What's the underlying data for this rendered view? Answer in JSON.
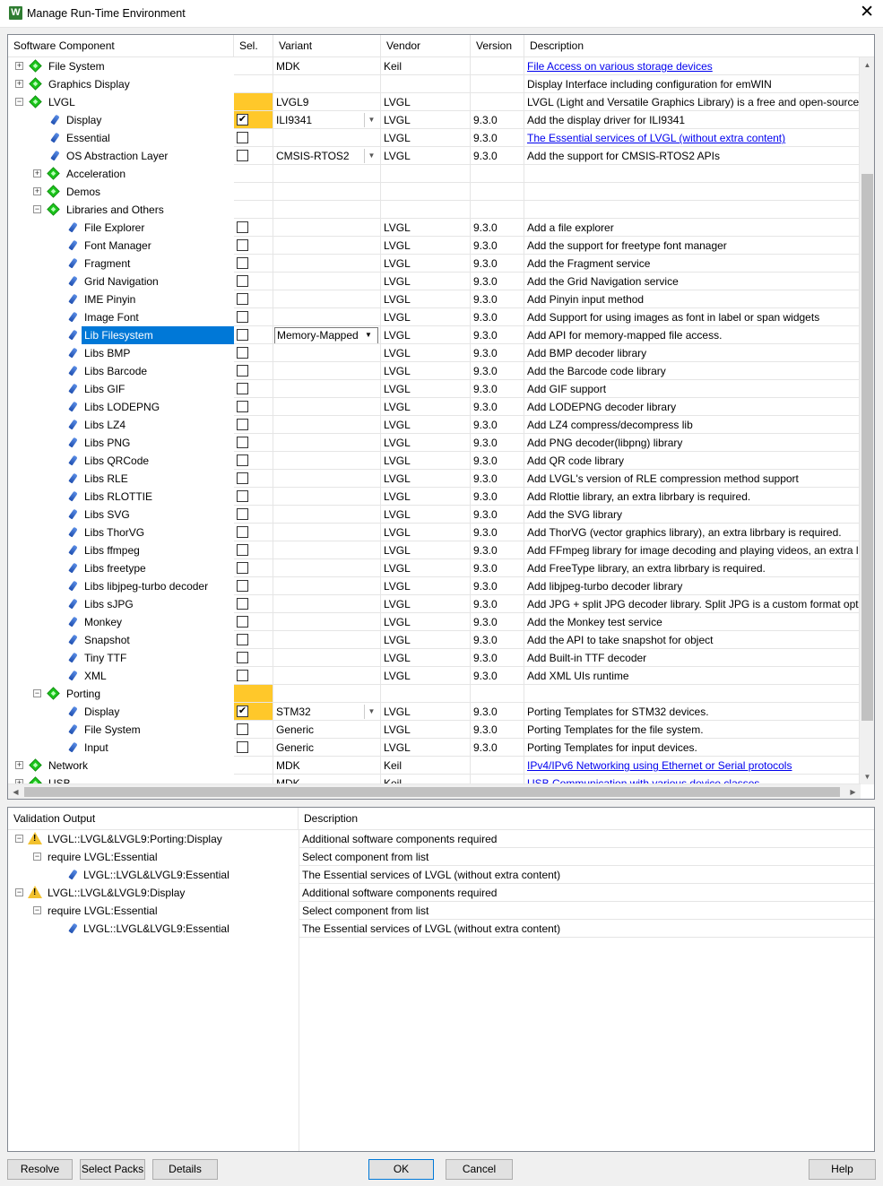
{
  "window": {
    "title": "Manage Run-Time Environment",
    "app_icon": "W",
    "close_glyph": "✕"
  },
  "columns": {
    "component": "Software Component",
    "sel": "Sel.",
    "variant": "Variant",
    "vendor": "Vendor",
    "version": "Version",
    "description": "Description"
  },
  "rows": [
    {
      "level": 0,
      "exp": "+",
      "icon": "gem",
      "label": "File System",
      "variant": "MDK",
      "vendor": "Keil",
      "desc": "File Access on various storage devices",
      "link": true
    },
    {
      "level": 0,
      "exp": "+",
      "icon": "gem",
      "label": "Graphics Display",
      "desc": "Display Interface including configuration for emWIN"
    },
    {
      "level": 0,
      "exp": "-",
      "icon": "gem",
      "label": "LVGL",
      "sel": "orange",
      "variant": "LVGL9",
      "vendor": "LVGL",
      "desc": "LVGL (Light and Versatile Graphics Library) is a free and open-source graphics library"
    },
    {
      "level": 1,
      "icon": "pin",
      "label": "Display",
      "sel": "checked-orange",
      "variant": "ILI9341",
      "dd": true,
      "vendor": "LVGL",
      "version": "9.3.0",
      "desc": "Add the display driver for ILI9341"
    },
    {
      "level": 1,
      "icon": "pin",
      "label": "Essential",
      "sel": "unchecked",
      "vendor": "LVGL",
      "version": "9.3.0",
      "desc": "The Essential services of LVGL (without extra content)",
      "link": true
    },
    {
      "level": 1,
      "icon": "pin",
      "label": "OS Abstraction Layer",
      "sel": "unchecked",
      "variant": "CMSIS-RTOS2",
      "dd": true,
      "vendor": "LVGL",
      "version": "9.3.0",
      "desc": "Add the support for CMSIS-RTOS2 APIs"
    },
    {
      "level": 1,
      "exp": "+",
      "icon": "gem",
      "label": "Acceleration"
    },
    {
      "level": 1,
      "exp": "+",
      "icon": "gem",
      "label": "Demos"
    },
    {
      "level": 1,
      "exp": "-",
      "icon": "gem",
      "label": "Libraries and Others"
    },
    {
      "level": 2,
      "icon": "pin",
      "label": "File Explorer",
      "sel": "unchecked",
      "vendor": "LVGL",
      "version": "9.3.0",
      "desc": "Add a file explorer"
    },
    {
      "level": 2,
      "icon": "pin",
      "label": "Font Manager",
      "sel": "unchecked",
      "vendor": "LVGL",
      "version": "9.3.0",
      "desc": "Add the support for freetype font manager"
    },
    {
      "level": 2,
      "icon": "pin",
      "label": "Fragment",
      "sel": "unchecked",
      "vendor": "LVGL",
      "version": "9.3.0",
      "desc": "Add the Fragment service"
    },
    {
      "level": 2,
      "icon": "pin",
      "label": "Grid Navigation",
      "sel": "unchecked",
      "vendor": "LVGL",
      "version": "9.3.0",
      "desc": "Add the Grid Navigation service"
    },
    {
      "level": 2,
      "icon": "pin",
      "label": "IME Pinyin",
      "sel": "unchecked",
      "vendor": "LVGL",
      "version": "9.3.0",
      "desc": "Add Pinyin input method"
    },
    {
      "level": 2,
      "icon": "pin",
      "label": "Image Font",
      "sel": "unchecked",
      "vendor": "LVGL",
      "version": "9.3.0",
      "desc": "Add Support for using images as font in label or span widgets"
    },
    {
      "level": 2,
      "icon": "pin",
      "label": "Lib Filesystem",
      "selected": true,
      "sel": "unchecked",
      "variant": "Memory-Mapped",
      "dd_open": true,
      "vendor": "LVGL",
      "version": "9.3.0",
      "desc": "Add API for memory-mapped file access."
    },
    {
      "level": 2,
      "icon": "pin",
      "label": "Libs BMP",
      "sel": "unchecked",
      "vendor": "LVGL",
      "version": "9.3.0",
      "desc": "Add BMP decoder library"
    },
    {
      "level": 2,
      "icon": "pin",
      "label": "Libs Barcode",
      "sel": "unchecked",
      "vendor": "LVGL",
      "version": "9.3.0",
      "desc": "Add the Barcode code library"
    },
    {
      "level": 2,
      "icon": "pin",
      "label": "Libs GIF",
      "sel": "unchecked",
      "vendor": "LVGL",
      "version": "9.3.0",
      "desc": "Add GIF support"
    },
    {
      "level": 2,
      "icon": "pin",
      "label": "Libs LODEPNG",
      "sel": "unchecked",
      "vendor": "LVGL",
      "version": "9.3.0",
      "desc": "Add LODEPNG decoder library"
    },
    {
      "level": 2,
      "icon": "pin",
      "label": "Libs LZ4",
      "sel": "unchecked",
      "vendor": "LVGL",
      "version": "9.3.0",
      "desc": "Add LZ4 compress/decompress lib"
    },
    {
      "level": 2,
      "icon": "pin",
      "label": "Libs PNG",
      "sel": "unchecked",
      "vendor": "LVGL",
      "version": "9.3.0",
      "desc": "Add PNG decoder(libpng) library"
    },
    {
      "level": 2,
      "icon": "pin",
      "label": "Libs QRCode",
      "sel": "unchecked",
      "vendor": "LVGL",
      "version": "9.3.0",
      "desc": "Add QR code library"
    },
    {
      "level": 2,
      "icon": "pin",
      "label": "Libs RLE",
      "sel": "unchecked",
      "vendor": "LVGL",
      "version": "9.3.0",
      "desc": "Add LVGL's version of RLE compression method support"
    },
    {
      "level": 2,
      "icon": "pin",
      "label": "Libs RLOTTIE",
      "sel": "unchecked",
      "vendor": "LVGL",
      "version": "9.3.0",
      "desc": "Add Rlottie library, an extra librbary is required."
    },
    {
      "level": 2,
      "icon": "pin",
      "label": "Libs SVG",
      "sel": "unchecked",
      "vendor": "LVGL",
      "version": "9.3.0",
      "desc": "Add the SVG library"
    },
    {
      "level": 2,
      "icon": "pin",
      "label": "Libs ThorVG",
      "sel": "unchecked",
      "vendor": "LVGL",
      "version": "9.3.0",
      "desc": "Add ThorVG (vector graphics library), an extra librbary is required."
    },
    {
      "level": 2,
      "icon": "pin",
      "label": "Libs ffmpeg",
      "sel": "unchecked",
      "vendor": "LVGL",
      "version": "9.3.0",
      "desc": "Add FFmpeg library for image decoding and playing videos, an extra librbary is required."
    },
    {
      "level": 2,
      "icon": "pin",
      "label": "Libs freetype",
      "sel": "unchecked",
      "vendor": "LVGL",
      "version": "9.3.0",
      "desc": "Add FreeType library, an extra librbary is required."
    },
    {
      "level": 2,
      "icon": "pin",
      "label": "Libs libjpeg-turbo decoder",
      "sel": "unchecked",
      "vendor": "LVGL",
      "version": "9.3.0",
      "desc": "Add libjpeg-turbo decoder library"
    },
    {
      "level": 2,
      "icon": "pin",
      "label": "Libs sJPG",
      "sel": "unchecked",
      "vendor": "LVGL",
      "version": "9.3.0",
      "desc": "Add JPG + split JPG decoder library. Split JPG is a custom format optimized for embedded"
    },
    {
      "level": 2,
      "icon": "pin",
      "label": "Monkey",
      "sel": "unchecked",
      "vendor": "LVGL",
      "version": "9.3.0",
      "desc": "Add the Monkey test service"
    },
    {
      "level": 2,
      "icon": "pin",
      "label": "Snapshot",
      "sel": "unchecked",
      "vendor": "LVGL",
      "version": "9.3.0",
      "desc": "Add the API to take snapshot for object"
    },
    {
      "level": 2,
      "icon": "pin",
      "label": "Tiny TTF",
      "sel": "unchecked",
      "vendor": "LVGL",
      "version": "9.3.0",
      "desc": "Add Built-in TTF decoder"
    },
    {
      "level": 2,
      "icon": "pin",
      "label": "XML",
      "sel": "unchecked",
      "vendor": "LVGL",
      "version": "9.3.0",
      "desc": "Add XML UIs runtime"
    },
    {
      "level": 1,
      "exp": "-",
      "icon": "gem",
      "label": "Porting",
      "sel": "orange"
    },
    {
      "level": 2,
      "icon": "pin",
      "label": "Display",
      "sel": "checked-orange",
      "variant": "STM32",
      "dd": true,
      "vendor": "LVGL",
      "version": "9.3.0",
      "desc": "Porting Templates for STM32 devices."
    },
    {
      "level": 2,
      "icon": "pin",
      "label": "File System",
      "sel": "unchecked",
      "variant": "Generic",
      "vendor": "LVGL",
      "version": "9.3.0",
      "desc": "Porting Templates for the file system."
    },
    {
      "level": 2,
      "icon": "pin",
      "label": "Input",
      "sel": "unchecked",
      "variant": "Generic",
      "vendor": "LVGL",
      "version": "9.3.0",
      "desc": "Porting Templates for input devices."
    },
    {
      "level": 0,
      "exp": "+",
      "icon": "gem",
      "label": "Network",
      "variant": "MDK",
      "vendor": "Keil",
      "desc": "IPv4/IPv6 Networking using Ethernet or Serial protocols",
      "link": true
    },
    {
      "level": 0,
      "exp": "+",
      "icon": "gem",
      "label": "USB",
      "variant": "MDK",
      "vendor": "Keil",
      "desc": "USB Communication with various device classes",
      "link": true
    }
  ],
  "validation": {
    "col_output": "Validation Output",
    "col_description": "Description",
    "rows": [
      {
        "level": 0,
        "exp": "-",
        "warn": true,
        "label": "LVGL::LVGL&LVGL9:Porting:Display",
        "desc": "Additional software components required"
      },
      {
        "level": 1,
        "exp": "-",
        "label": "require LVGL:Essential",
        "desc": "Select component from list"
      },
      {
        "level": 2,
        "pin": true,
        "label": "LVGL::LVGL&LVGL9:Essential",
        "desc": "The Essential services of LVGL (without extra content)"
      },
      {
        "level": 0,
        "exp": "-",
        "warn": true,
        "label": "LVGL::LVGL&LVGL9:Display",
        "desc": "Additional software components required"
      },
      {
        "level": 1,
        "exp": "-",
        "label": "require LVGL:Essential",
        "desc": "Select component from list"
      },
      {
        "level": 2,
        "pin": true,
        "label": "LVGL::LVGL&LVGL9:Essential",
        "desc": "The Essential services of LVGL (without extra content)"
      }
    ]
  },
  "buttons": {
    "resolve": "Resolve",
    "select_packs": "Select Packs",
    "details": "Details",
    "ok": "OK",
    "cancel": "Cancel",
    "help": "Help"
  },
  "colors": {
    "selection": "#0078d7",
    "mandatory": "#ffc82a",
    "link": "#0000ee"
  }
}
